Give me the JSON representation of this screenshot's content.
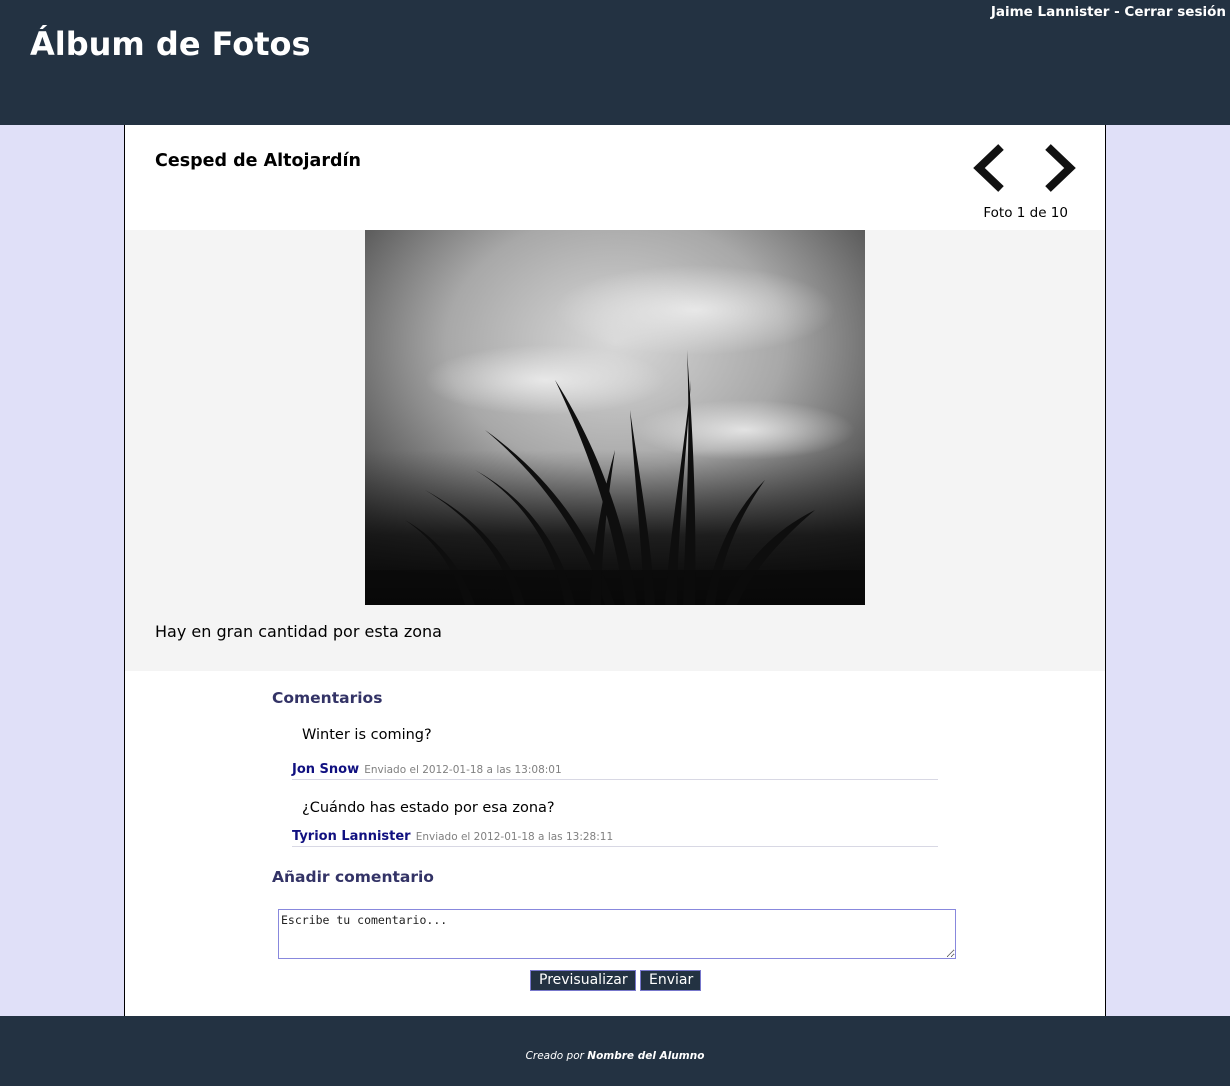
{
  "header": {
    "site_title": "Álbum de Fotos",
    "user_name": "Jaime Lannister",
    "separator": " - ",
    "logout_label": "Cerrar sesión"
  },
  "photo": {
    "title": "Cesped de Altojardín",
    "counter": "Foto 1 de 10",
    "caption": "Hay en gran cantidad por esta zona",
    "nav_prev_icon": "chevron-left-icon",
    "nav_next_icon": "chevron-right-icon"
  },
  "comments": {
    "title": "Comentarios",
    "items": [
      {
        "text": "Winter is coming?",
        "author": "Jon Snow",
        "date": "Enviado el 2012-01-18 a las 13:08:01"
      },
      {
        "text": "¿Cuándo has estado por esa zona?",
        "author": "Tyrion Lannister",
        "date": "Enviado el 2012-01-18 a las 13:28:11"
      }
    ]
  },
  "add_comment": {
    "title": "Añadir comentario",
    "placeholder": "Escribe tu comentario...",
    "preview_label": "Previsualizar",
    "send_label": "Enviar"
  },
  "footer": {
    "prefix": "Creado por ",
    "author": "Nombre del Alumno"
  },
  "colors": {
    "header_bg": "#233242",
    "page_bg": "#e0e0f8",
    "section_title": "#333366",
    "author_link": "#101080"
  }
}
